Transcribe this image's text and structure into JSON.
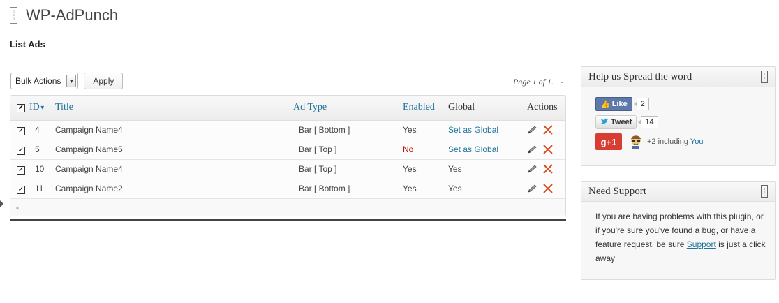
{
  "header": {
    "title": "WP-AdPunch",
    "subtitle": "List Ads"
  },
  "toolbar": {
    "bulk_actions_label": "Bulk Actions",
    "apply_label": "Apply",
    "pagination": "Page 1 of 1.",
    "pagination_suffix": "-"
  },
  "table": {
    "columns": {
      "id": "ID",
      "title": "Title",
      "ad_type": "Ad Type",
      "enabled": "Enabled",
      "global": "Global",
      "actions": "Actions"
    },
    "rows": [
      {
        "id": "4",
        "title": "Campaign Name4",
        "ad_type": "Bar [ Bottom ]",
        "enabled": "Yes",
        "global": "Set as Global",
        "global_is_link": true,
        "checked": true
      },
      {
        "id": "5",
        "title": "Campaign Name5",
        "ad_type": "Bar [ Top ]",
        "enabled": "No",
        "global": "Set as Global",
        "global_is_link": true,
        "checked": true
      },
      {
        "id": "10",
        "title": "Campaign Name4",
        "ad_type": "Bar [ Top ]",
        "enabled": "Yes",
        "global": "Yes",
        "global_is_link": false,
        "checked": true
      },
      {
        "id": "11",
        "title": "Campaign Name2",
        "ad_type": "Bar [ Bottom ]",
        "enabled": "Yes",
        "global": "Yes",
        "global_is_link": false,
        "checked": true
      }
    ],
    "footer": "-"
  },
  "sidebar": {
    "spread": {
      "title": "Help us Spread the word",
      "like_label": "Like",
      "like_count": "2",
      "tweet_label": "Tweet",
      "tweet_count": "14",
      "gplus_label": "g+1",
      "gplus_text": "+2 including",
      "gplus_you": "You"
    },
    "support": {
      "title": "Need Support",
      "text_before": "If you are having problems with this plugin, or if you're sure you've found a bug, or have a feature request, be sure",
      "link": "Support",
      "text_after": "is just a click away"
    }
  },
  "colors": {
    "link": "#21759b",
    "no": "#cc0000",
    "delete": "#d54e21",
    "facebook": "#5f78ab",
    "gplus": "#d73d32"
  }
}
